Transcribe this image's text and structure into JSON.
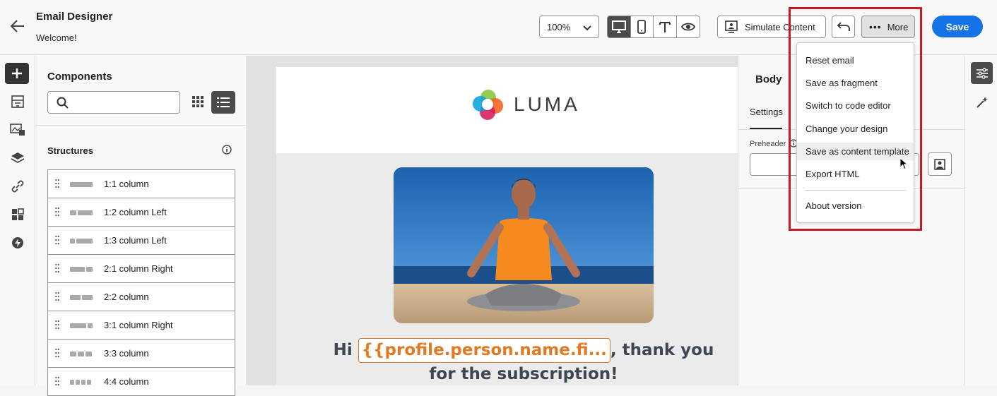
{
  "header": {
    "title": "Email Designer",
    "subtitle": "Welcome!",
    "zoom_value": "100%",
    "simulate_label": "Simulate Content",
    "more_label": "More",
    "save_label": "Save"
  },
  "components": {
    "title": "Components",
    "search_placeholder": "",
    "structures_title": "Structures",
    "structures": [
      {
        "label": "1:1 column"
      },
      {
        "label": "1:2 column Left"
      },
      {
        "label": "1:3 column Left"
      },
      {
        "label": "2:1 column Right"
      },
      {
        "label": "2:2 column"
      },
      {
        "label": "3:1 column Right"
      },
      {
        "label": "3:3 column"
      },
      {
        "label": "4:4 column"
      }
    ]
  },
  "email": {
    "logo_text": "LUMA",
    "greeting_pre": "Hi ",
    "token": "{{profile.person.name.fi...",
    "greeting_post": ", thank you",
    "greeting_line2": "for the subscription!"
  },
  "right_panel": {
    "title": "Body",
    "tab_settings": "Settings",
    "preheader_label": "Preheader"
  },
  "more_menu": {
    "items": [
      {
        "label": "Reset email"
      },
      {
        "label": "Save as fragment"
      },
      {
        "label": "Switch to code editor"
      },
      {
        "label": "Change your design"
      },
      {
        "label": "Save as content template"
      },
      {
        "label": "Export HTML"
      },
      {
        "label": "About version"
      }
    ],
    "hovered_item": "Save as content template"
  },
  "colors": {
    "accent": "#1473e6",
    "highlight_box": "#c8191f",
    "token": "#e07b24"
  }
}
